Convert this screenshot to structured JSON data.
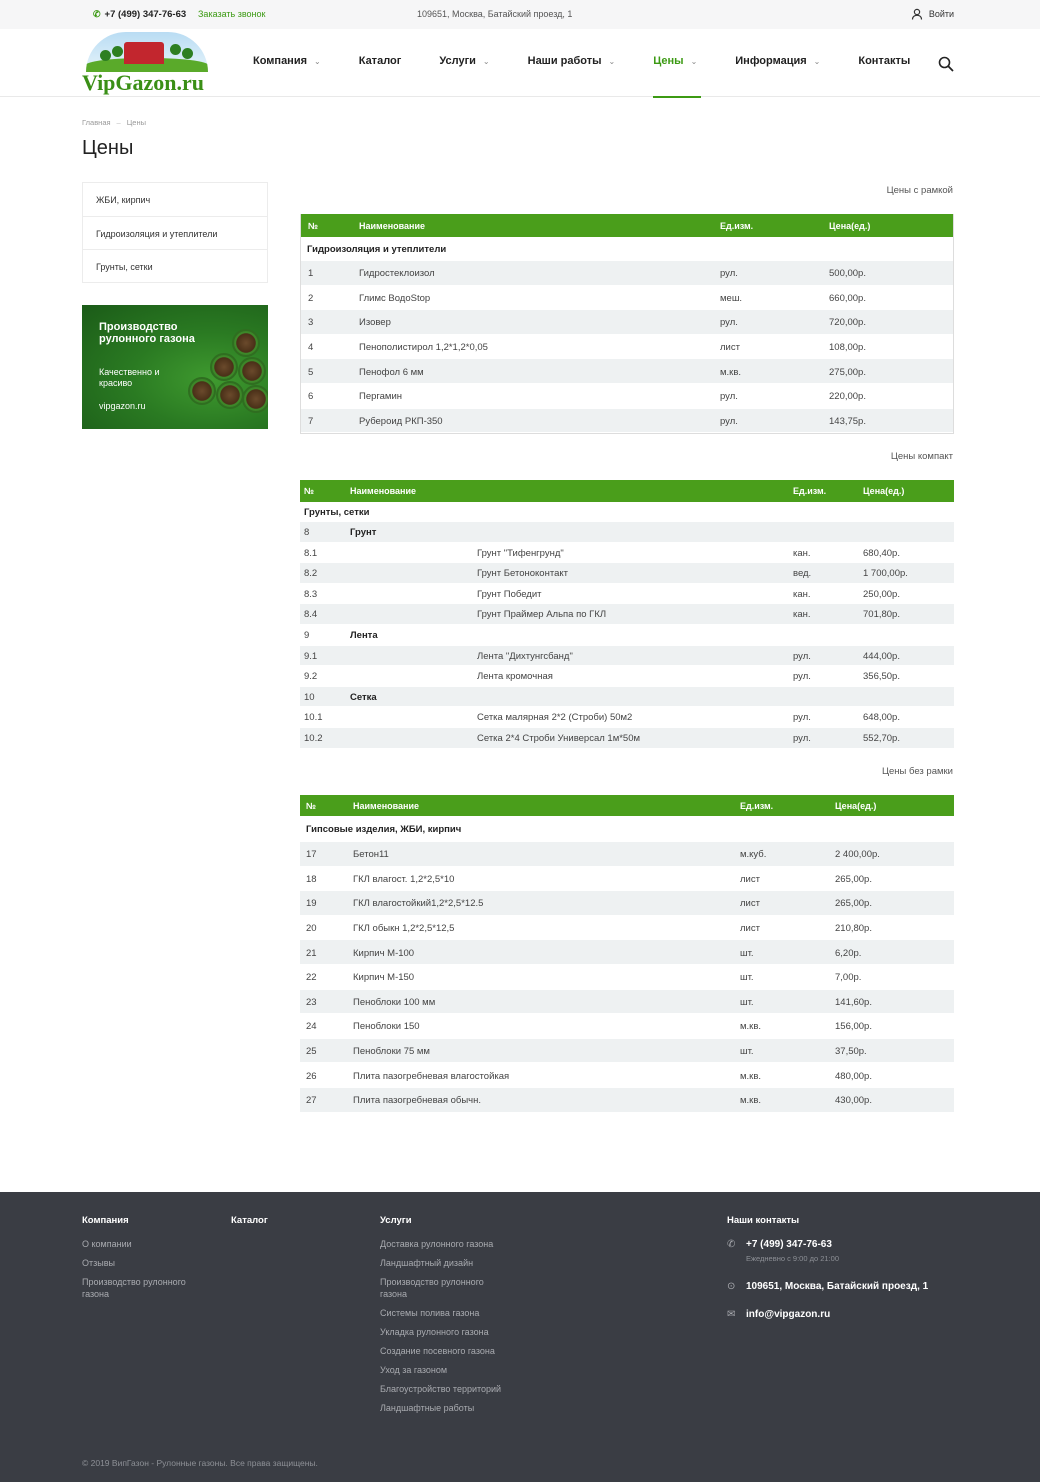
{
  "topbar": {
    "phone": "+7 (499) 347-76-63",
    "callback": "Заказать звонок",
    "address": "109651, Москва, Батайский проезд, 1",
    "login": "Войти"
  },
  "logo": {
    "text": "VipGazon.ru"
  },
  "nav": {
    "items": [
      {
        "label": "Компания",
        "has_dropdown": true
      },
      {
        "label": "Каталог",
        "has_dropdown": false
      },
      {
        "label": "Услуги",
        "has_dropdown": true
      },
      {
        "label": "Наши работы",
        "has_dropdown": true
      },
      {
        "label": "Цены",
        "has_dropdown": true,
        "active": true
      },
      {
        "label": "Информация",
        "has_dropdown": true
      },
      {
        "label": "Контакты",
        "has_dropdown": false
      }
    ]
  },
  "breadcrumb": {
    "home": "Главная",
    "current": "Цены"
  },
  "page_title": "Цены",
  "sidebar": {
    "items": [
      "ЖБИ, кирпич",
      "Гидроизоляция и утеплители",
      "Грунты, сетки"
    ],
    "banner": {
      "title": "Производство рулонного газона",
      "subtitle": "Качественно и красиво",
      "site": "vipgazon.ru"
    }
  },
  "table1": {
    "caption": "Цены с рамкой",
    "headers": [
      "№",
      "Наименование",
      "Ед.изм.",
      "Цена(ед.)"
    ],
    "group": "Гидроизоляция и утеплители",
    "rows": [
      [
        "1",
        "Гидростеклоизол",
        "рул.",
        "500,00р."
      ],
      [
        "2",
        "Глимс ВодоStop",
        "меш.",
        "660,00р."
      ],
      [
        "3",
        "Изовер",
        "рул.",
        "720,00р."
      ],
      [
        "4",
        "Пенополистирол 1,2*1,2*0,05",
        "лист",
        "108,00р."
      ],
      [
        "5",
        "Пенофол 6 мм",
        "м.кв.",
        "275,00р."
      ],
      [
        "6",
        "Пергамин",
        "рул.",
        "220,00р."
      ],
      [
        "7",
        "Рубероид РКП-350",
        "рул.",
        "143,75р."
      ]
    ]
  },
  "table2": {
    "caption": "Цены компакт",
    "headers": [
      "№",
      "Наименование",
      "Ед.изм.",
      "Цена(ед.)"
    ],
    "group": "Грунты, сетки",
    "rows": [
      {
        "num": "8",
        "sub": "Грунт",
        "name": "",
        "unit": "",
        "price": ""
      },
      {
        "num": "8.1",
        "sub": "",
        "name": "Грунт \"Тифенгрунд\"",
        "unit": "кан.",
        "price": "680,40р."
      },
      {
        "num": "8.2",
        "sub": "",
        "name": "Грунт Бетоноконтакт",
        "unit": "вед.",
        "price": "1 700,00р."
      },
      {
        "num": "8.3",
        "sub": "",
        "name": "Грунт Победит",
        "unit": "кан.",
        "price": "250,00р."
      },
      {
        "num": "8.4",
        "sub": "",
        "name": "Грунт Праймер Альпа по ГКЛ",
        "unit": "кан.",
        "price": "701,80р."
      },
      {
        "num": "9",
        "sub": "Лента",
        "name": "",
        "unit": "",
        "price": ""
      },
      {
        "num": "9.1",
        "sub": "",
        "name": "Лента \"Дихтунгсбанд\"",
        "unit": "рул.",
        "price": "444,00р."
      },
      {
        "num": "9.2",
        "sub": "",
        "name": "Лента кромочная",
        "unit": "рул.",
        "price": "356,50р."
      },
      {
        "num": "10",
        "sub": "Сетка",
        "name": "",
        "unit": "",
        "price": ""
      },
      {
        "num": "10.1",
        "sub": "",
        "name": "Сетка малярная 2*2 (Строби) 50м2",
        "unit": "рул.",
        "price": "648,00р."
      },
      {
        "num": "10.2",
        "sub": "",
        "name": "Сетка 2*4 Строби Универсал 1м*50м",
        "unit": "рул.",
        "price": "552,70р."
      }
    ]
  },
  "table3": {
    "caption": "Цены без рамки",
    "headers": [
      "№",
      "Наименование",
      "Ед.изм.",
      "Цена(ед.)"
    ],
    "group": "Гипсовые изделия, ЖБИ, кирпич",
    "rows": [
      [
        "17",
        "Бетон11",
        "м.куб.",
        "2 400,00р."
      ],
      [
        "18",
        "ГКЛ влагост. 1,2*2,5*10",
        "лист",
        "265,00р."
      ],
      [
        "19",
        "ГКЛ влагостойкий1,2*2,5*12.5",
        "лист",
        "265,00р."
      ],
      [
        "20",
        "ГКЛ обыкн 1,2*2,5*12,5",
        "лист",
        "210,80р."
      ],
      [
        "21",
        "Кирпич М-100",
        "шт.",
        "6,20р."
      ],
      [
        "22",
        "Кирпич М-150",
        "шт.",
        "7,00р."
      ],
      [
        "23",
        "Пеноблоки 100 мм",
        "шт.",
        "141,60р."
      ],
      [
        "24",
        "Пеноблоки 150",
        "м.кв.",
        "156,00р."
      ],
      [
        "25",
        "Пеноблоки 75 мм",
        "шт.",
        "37,50р."
      ],
      [
        "26",
        "Плита пазогребневая влагостойкая",
        "м.кв.",
        "480,00р."
      ],
      [
        "27",
        "Плита пазогребневая обычн.",
        "м.кв.",
        "430,00р."
      ]
    ]
  },
  "footer": {
    "company": {
      "title": "Компания",
      "links": [
        "О компании",
        "Отзывы",
        "Производство рулонного газона"
      ]
    },
    "catalog": {
      "title": "Каталог"
    },
    "services": {
      "title": "Услуги",
      "links": [
        "Доставка рулонного газона",
        "Ландшафтный дизайн",
        "Производство рулонного газона",
        "Системы полива газона",
        "Укладка рулонного газона",
        "Создание посевного газона",
        "Уход за газоном",
        "Благоустройство территорий",
        "Ландшафтные работы"
      ]
    },
    "contacts": {
      "title": "Наши контакты",
      "phone": "+7 (499) 347-76-63",
      "hours": "Ежедневно с 9:00 до 21:00",
      "address": "109651, Москва, Батайский проезд, 1",
      "email": "info@vipgazon.ru"
    },
    "copyright": "© 2019 ВипГазон - Рулонные газоны. Все права защищены."
  },
  "colors": {
    "accent": "#4a9e1b",
    "footer_bg": "#3a3d44"
  }
}
